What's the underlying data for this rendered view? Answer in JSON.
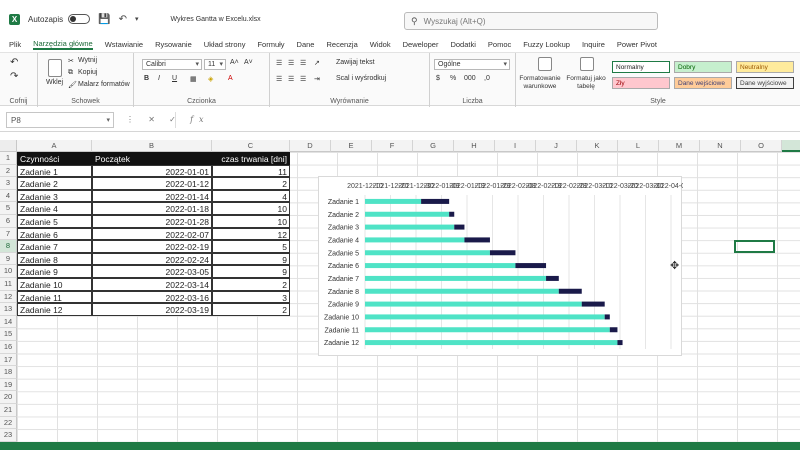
{
  "titlebar": {
    "app_icon": "excel-icon",
    "autosave_label": "Autozapis",
    "doc_title": "Wykres Gantta w Excelu.xlsx",
    "search_placeholder": "Wyszukaj (Alt+Q)"
  },
  "tabs": [
    "Plik",
    "Narzędzia główne",
    "Wstawianie",
    "Rysowanie",
    "Układ strony",
    "Formuły",
    "Dane",
    "Recenzja",
    "Widok",
    "Deweloper",
    "Dodatki",
    "Pomoc",
    "Fuzzy Lookup",
    "Inquire",
    "Power Pivot"
  ],
  "active_tab": "Narzędzia główne",
  "ribbon": {
    "undo_group": "Cofnij",
    "paste_label": "Wklej",
    "cut_label": "Wytnij",
    "copy_label": "Kopiuj",
    "format_painter_label": "Malarz formatów",
    "clipboard_group": "Schowek",
    "font_name": "Calibri",
    "font_size": "11",
    "font_group": "Czcionka",
    "wrap_text": "Zawijaj tekst",
    "merge_center": "Scal i wyśrodkuj",
    "alignment_group": "Wyrównanie",
    "number_format": "Ogólne",
    "number_group": "Liczba",
    "conditional_formatting": "Formatowanie warunkowe",
    "format_as_table": "Formatuj jako tabelę",
    "styles_group": "Style",
    "styles": [
      {
        "label": "Normalny",
        "bg": "#ffffff",
        "fg": "#222222",
        "border": "#1f7a45"
      },
      {
        "label": "Dobry",
        "bg": "#c6efce",
        "fg": "#006100",
        "border": "#aaaaaa"
      },
      {
        "label": "Neutralny",
        "bg": "#ffeb9c",
        "fg": "#9c5700",
        "border": "#aaaaaa"
      },
      {
        "label": "Zły",
        "bg": "#ffc7ce",
        "fg": "#9c0006",
        "border": "#aaaaaa"
      },
      {
        "label": "Dane wejściowe",
        "bg": "#ffcc99",
        "fg": "#3f3f76",
        "border": "#aaaaaa"
      },
      {
        "label": "Dane wyjściowe",
        "bg": "#f2f2f2",
        "fg": "#3f3f3f",
        "border": "#3f3f3f"
      }
    ]
  },
  "formula_bar": {
    "name_box": "P8",
    "fx_label": "fx",
    "formula": ""
  },
  "columns": [
    "A",
    "B",
    "C",
    "D",
    "E",
    "F",
    "G",
    "H",
    "I",
    "J",
    "K",
    "L",
    "M",
    "N",
    "O",
    "P"
  ],
  "selected_column": "P",
  "rows": [
    "1",
    "2",
    "3",
    "4",
    "5",
    "6",
    "7",
    "8",
    "9",
    "10",
    "11",
    "12",
    "13",
    "14",
    "15",
    "16",
    "17",
    "18",
    "19",
    "20",
    "21",
    "22",
    "23"
  ],
  "selected_row": "8",
  "table": {
    "headers": [
      "Czynności",
      "Początek",
      "czas trwania [dni]"
    ],
    "rows": [
      [
        "Zadanie 1",
        "2022-01-01",
        "11"
      ],
      [
        "Zadanie 2",
        "2022-01-12",
        "2"
      ],
      [
        "Zadanie 3",
        "2022-01-14",
        "4"
      ],
      [
        "Zadanie 4",
        "2022-01-18",
        "10"
      ],
      [
        "Zadanie 5",
        "2022-01-28",
        "10"
      ],
      [
        "Zadanie 6",
        "2022-02-07",
        "12"
      ],
      [
        "Zadanie 7",
        "2022-02-19",
        "5"
      ],
      [
        "Zadanie 8",
        "2022-02-24",
        "9"
      ],
      [
        "Zadanie 9",
        "2022-03-05",
        "9"
      ],
      [
        "Zadanie 10",
        "2022-03-14",
        "2"
      ],
      [
        "Zadanie 11",
        "2022-03-16",
        "3"
      ],
      [
        "Zadanie 12",
        "2022-03-19",
        "2"
      ]
    ]
  },
  "chart_data": {
    "type": "bar",
    "orientation": "horizontal-stacked",
    "categories": [
      "Zadanie 1",
      "Zadanie 2",
      "Zadanie 3",
      "Zadanie 4",
      "Zadanie 5",
      "Zadanie 6",
      "Zadanie 7",
      "Zadanie 8",
      "Zadanie 9",
      "Zadanie 10",
      "Zadanie 11",
      "Zadanie 12"
    ],
    "start": [
      "2022-01-01",
      "2022-01-12",
      "2022-01-14",
      "2022-01-18",
      "2022-01-28",
      "2022-02-07",
      "2022-02-19",
      "2022-02-24",
      "2022-03-05",
      "2022-03-14",
      "2022-03-16",
      "2022-03-19"
    ],
    "duration": [
      11,
      2,
      4,
      10,
      10,
      12,
      5,
      9,
      9,
      2,
      3,
      2
    ],
    "xlim": [
      "2021-12-10",
      "2022-04-09"
    ],
    "x_ticks": [
      "2021-12-10",
      "2021-12-20",
      "2021-12-30",
      "2022-01-09",
      "2022-01-19",
      "2022-01-29",
      "2022-02-08",
      "2022-02-18",
      "2022-02-28",
      "2022-03-10",
      "2022-03-20",
      "2022-03-30",
      "2022-04-09"
    ],
    "x_tick_labels": [
      "2021-12-10",
      "2021-12-20",
      "2021-12-30",
      "2022-01-09",
      "2022-01-19",
      "2022-01-29",
      "2022-02-08",
      "2022-02-18",
      "2022-02-28",
      "2022-03-10",
      "2022-03-20",
      "2022-03-30",
      "2022-04-09"
    ],
    "axis_position": "top",
    "categories_reversed": true,
    "colors": {
      "start": "#4fe3c6",
      "duration": "#1a1a4a",
      "grid": "#d6d6d6"
    },
    "title": "",
    "xlabel": "",
    "ylabel": "",
    "grid": true
  }
}
